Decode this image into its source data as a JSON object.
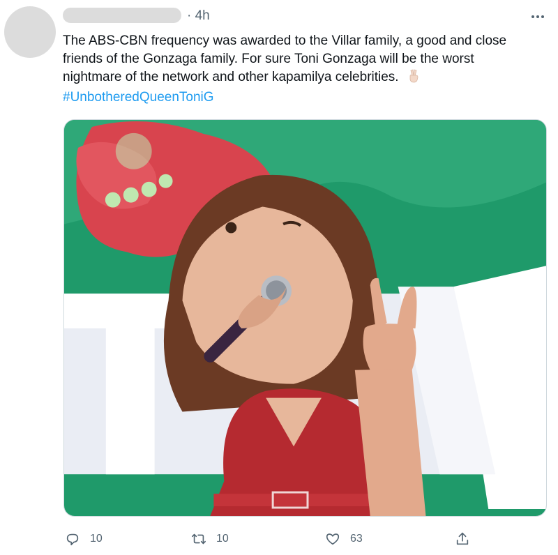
{
  "tweet": {
    "timestamp": "· 4h",
    "text_lines": [
      "The ABS-CBN frequency was awarded to the Villar family, a good and close",
      "friends of the Gonzaga family. For sure Toni Gonzaga will be the worst",
      "nightmare of the network and other kapamilya celebrities."
    ],
    "emoji": "victory-hand-emoji",
    "hashtag": "#UnbotheredQueenToniG"
  },
  "actions": {
    "reply_count": "10",
    "retweet_count": "10",
    "like_count": "63"
  },
  "icons": {
    "reply": "reply-icon",
    "retweet": "retweet-icon",
    "like": "heart-icon",
    "share": "share-icon",
    "more": "more-icon"
  },
  "colors": {
    "link": "#1d9bf0",
    "secondary_text": "#536471",
    "stage_green": "#1f9a6a",
    "stage_red": "#d8444e",
    "dress_red": "#b52a30"
  }
}
